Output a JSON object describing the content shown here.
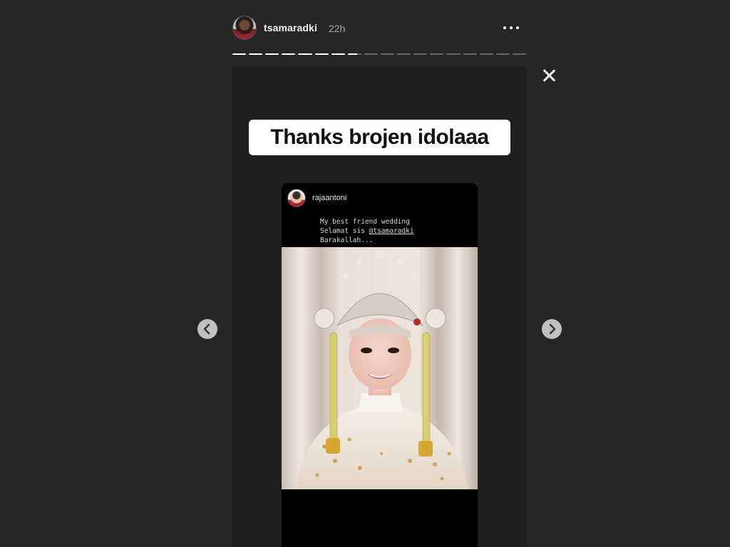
{
  "story": {
    "username": "tsamaradki",
    "time_ago": "22h",
    "progress": {
      "total_segments": 18,
      "completed_segments": 7,
      "current_segment_fraction": 0.7
    }
  },
  "caption_sticker": {
    "text": "Thanks brojen idolaaa"
  },
  "shared_post": {
    "username": "rajaantoni",
    "caption_line1": "My best friend wedding",
    "caption_line2_prefix": "Selamat sis ",
    "caption_mention": "@tsamaradki",
    "caption_line3": "Barakallah..."
  },
  "icons": {
    "more": "more-horizontal-icon",
    "close": "close-icon",
    "prev": "chevron-left-icon",
    "next": "chevron-right-icon"
  },
  "colors": {
    "background": "#262626",
    "frame": "#1f1f1f",
    "sticker": "#ffffff"
  }
}
